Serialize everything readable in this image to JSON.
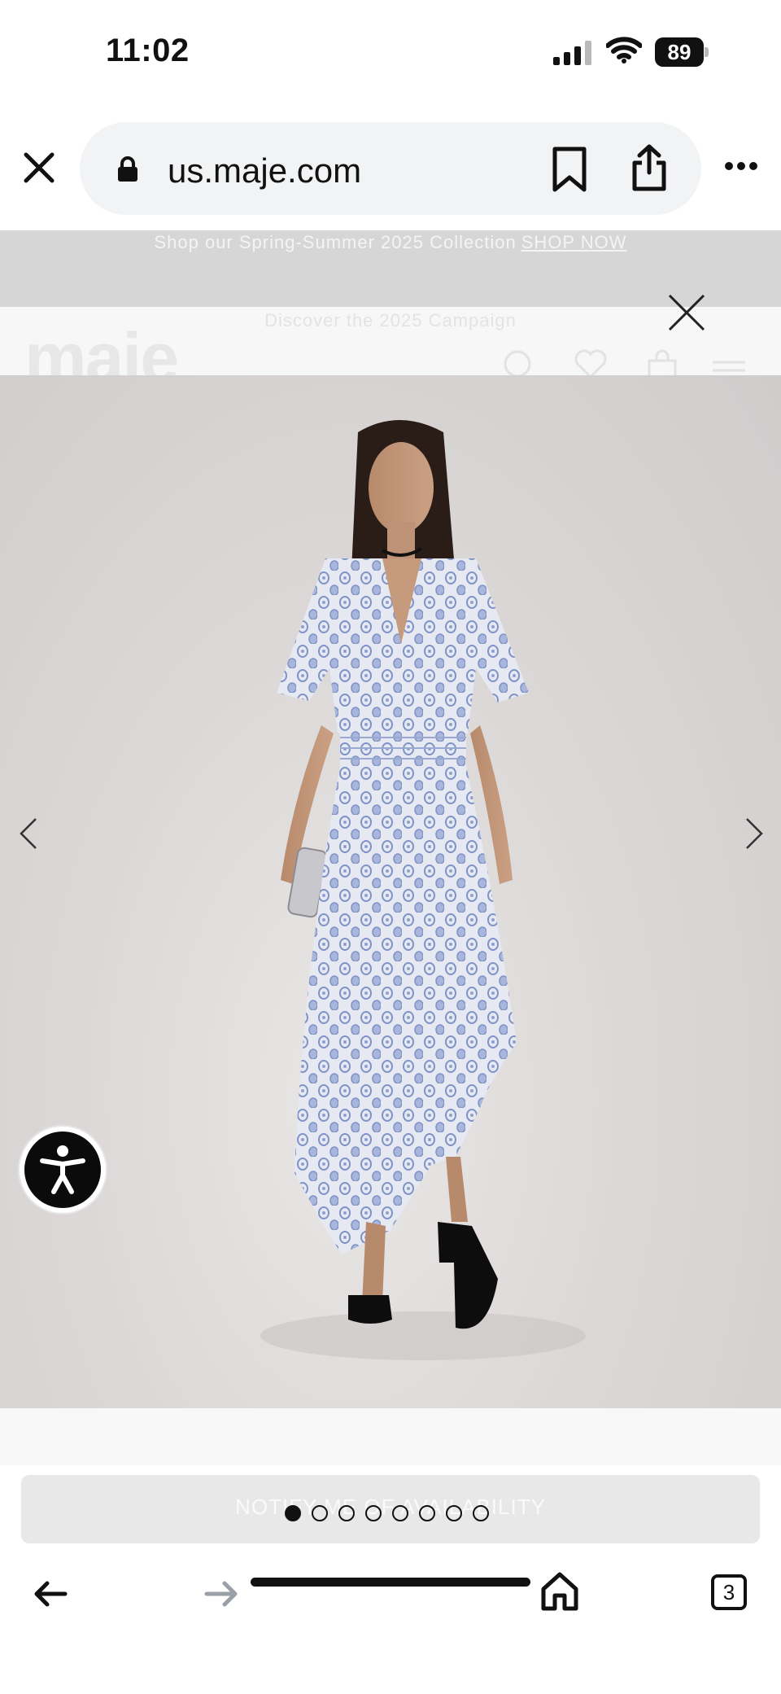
{
  "status_bar": {
    "time": "11:02",
    "battery": "89"
  },
  "browser": {
    "url": "us.maje.com",
    "tabs_count": "3"
  },
  "site": {
    "promo_text": "Shop our Spring-Summer 2025 Collection",
    "promo_link": "SHOP NOW",
    "campaign_text": "Discover the 2025 Campaign",
    "logo": "maje"
  },
  "gallery": {
    "image_count": 8,
    "active_index": 0,
    "dress_colors": {
      "base": "#e6e9f1",
      "print": "#7f93c6"
    }
  },
  "product": {
    "notify_label": "NOTIFY ME OF AVAILABILITY"
  },
  "colors": {
    "background": "#ffffff",
    "photo_bg": "#d9d6d6",
    "text": "#111111"
  }
}
